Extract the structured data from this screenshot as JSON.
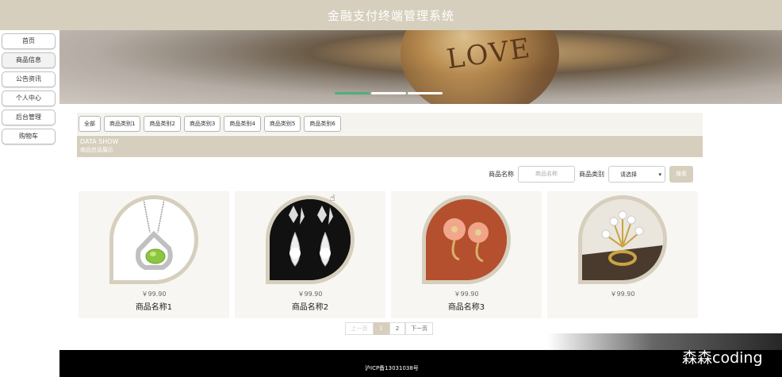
{
  "header": {
    "title": "金融支付终端管理系统"
  },
  "sidebar": {
    "items": [
      {
        "label": "首页"
      },
      {
        "label": "商品信息"
      },
      {
        "label": "公告资讯"
      },
      {
        "label": "个人中心"
      },
      {
        "label": "后台管理"
      },
      {
        "label": "购物车"
      }
    ]
  },
  "banner": {
    "text": "LOVE",
    "active_slide": 1,
    "slide_count": 3
  },
  "tabs": [
    {
      "label": "全部"
    },
    {
      "label": "商品类别1"
    },
    {
      "label": "商品类别2"
    },
    {
      "label": "商品类别3"
    },
    {
      "label": "商品类别4"
    },
    {
      "label": "商品类别5"
    },
    {
      "label": "商品类别6"
    }
  ],
  "section": {
    "title": "DATA SHOW",
    "subtitle": "商品信息展示"
  },
  "search": {
    "name_label": "商品名称",
    "name_placeholder": "商品名称",
    "category_label": "商品类别",
    "category_value": "请选择",
    "button": "搜索"
  },
  "products": [
    {
      "price": "￥99.90",
      "name": "商品名称1",
      "image": "green-pendant-necklace"
    },
    {
      "price": "￥99.90",
      "name": "商品名称2",
      "image": "crystal-drop-earrings"
    },
    {
      "price": "￥99.90",
      "name": "商品名称3",
      "image": "flower-earrings"
    },
    {
      "price": "￥99.90",
      "name": "",
      "image": "pearl-ring"
    }
  ],
  "pager": {
    "prev": "上一页",
    "pages": [
      "1",
      "2"
    ],
    "current": "1",
    "next": "下一页"
  },
  "footer": {
    "icp": "沪ICP备13031038号"
  },
  "watermark": "森森coding",
  "colors": {
    "accent": "#d6cfbd",
    "footer": "#000000"
  }
}
